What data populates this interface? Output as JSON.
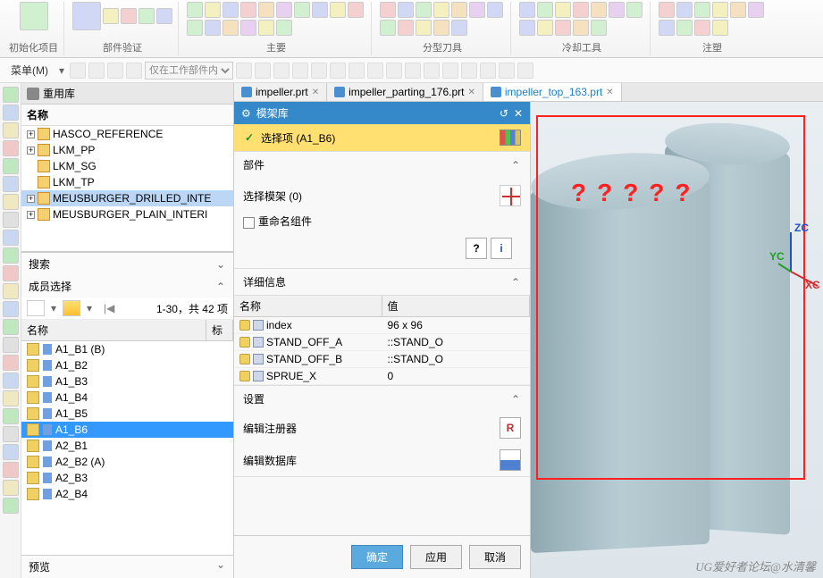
{
  "ribbon": {
    "groups": [
      {
        "label": "初始化项目"
      },
      {
        "label": "部件验证"
      },
      {
        "label": "主要"
      },
      {
        "label": "分型刀具"
      },
      {
        "label": "冷却工具"
      },
      {
        "label": "注塑"
      }
    ]
  },
  "menubar": {
    "menu_label": "菜单(M)",
    "dropdown_placeholder": "仅在工作部件内"
  },
  "reuse_lib": {
    "title": "重用库",
    "name_col": "名称",
    "items": [
      {
        "label": "HASCO_REFERENCE",
        "exp": true
      },
      {
        "label": "LKM_PP",
        "exp": true
      },
      {
        "label": "LKM_SG",
        "exp": false
      },
      {
        "label": "LKM_TP",
        "exp": false
      },
      {
        "label": "MEUSBURGER_DRILLED_INTE",
        "exp": true,
        "sel": true
      },
      {
        "label": "MEUSBURGER_PLAIN_INTERI",
        "exp": true
      }
    ]
  },
  "search": {
    "title": "搜索"
  },
  "members": {
    "title": "成员选择",
    "range": "1-30，共 42 项",
    "name_col": "名称",
    "std_col": "标",
    "rows": [
      {
        "label": "A1_B1 (B)"
      },
      {
        "label": "A1_B2"
      },
      {
        "label": "A1_B3"
      },
      {
        "label": "A1_B4"
      },
      {
        "label": "A1_B5"
      },
      {
        "label": "A1_B6",
        "sel": true
      },
      {
        "label": "A2_B1"
      },
      {
        "label": "A2_B2 (A)"
      },
      {
        "label": "A2_B3"
      },
      {
        "label": "A2_B4"
      }
    ]
  },
  "preview": {
    "title": "预览"
  },
  "tabs": [
    {
      "label": "impeller.prt"
    },
    {
      "label": "impeller_parting_176.prt"
    },
    {
      "label": "impeller_top_163.prt",
      "active": true
    }
  ],
  "dialog": {
    "title": "模架库",
    "selection": "选择项 (A1_B6)",
    "part_section": "部件",
    "select_mold": "选择模架 (0)",
    "rename_cb": "重命名组件",
    "detail_section": "详细信息",
    "detail_name": "名称",
    "detail_value": "值",
    "rows": [
      {
        "name": "index",
        "value": "96 x 96"
      },
      {
        "name": "STAND_OFF_A",
        "value": "<UM_VAR>::STAND_O"
      },
      {
        "name": "STAND_OFF_B",
        "value": "<UM_VAR>::STAND_O"
      },
      {
        "name": "SPRUE_X",
        "value": "0"
      }
    ],
    "settings_section": "设置",
    "edit_register": "编辑注册器",
    "edit_database": "编辑数据库",
    "ok": "确定",
    "apply": "应用",
    "cancel": "取消"
  },
  "viewport": {
    "qmarks": "?????",
    "axis_z": "ZC",
    "axis_y": "YC",
    "axis_x": "XC"
  },
  "watermark": "UG爱好者论坛@水清馨"
}
